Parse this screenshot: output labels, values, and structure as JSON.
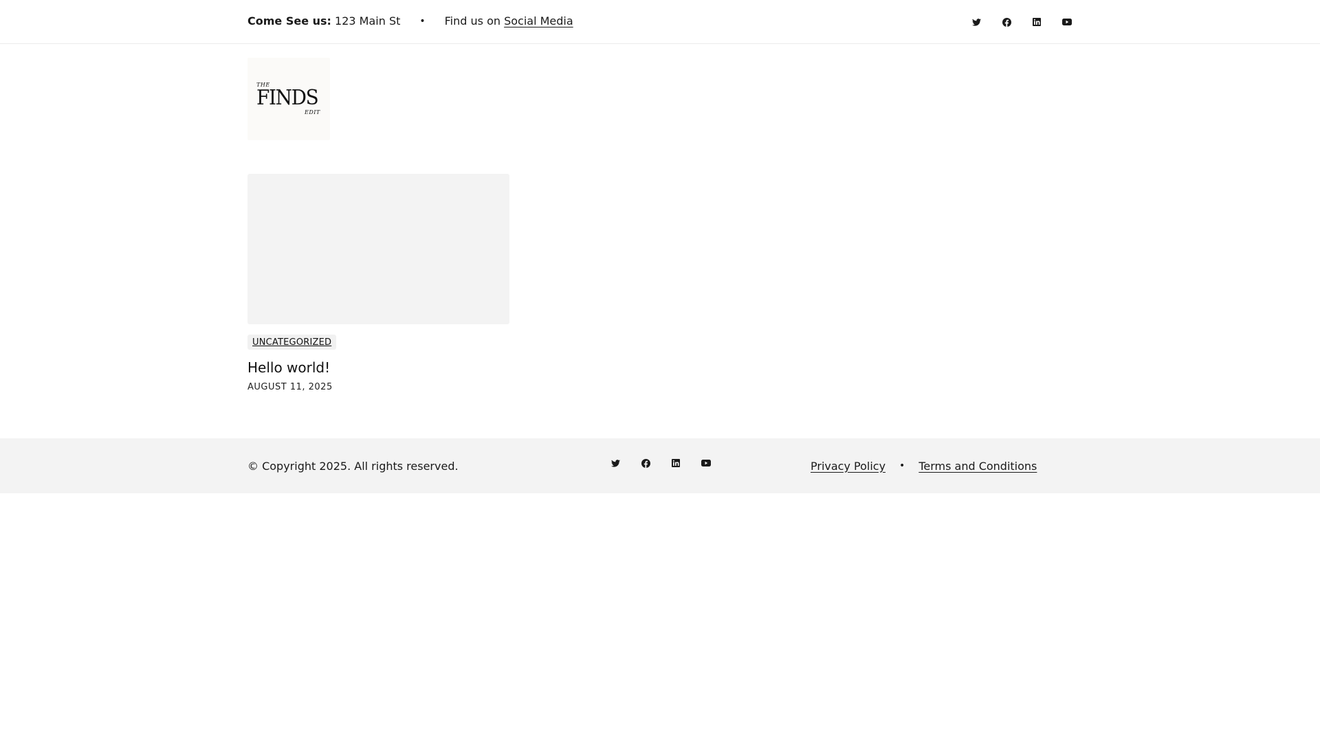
{
  "topbar": {
    "address_label": "Come See us:",
    "address_value": "123 Main St",
    "separator": "•",
    "social_prefix": "Find us on",
    "social_link": "Social Media",
    "social_icons": [
      "twitter-icon",
      "facebook-icon",
      "linkedin-icon",
      "youtube-icon"
    ]
  },
  "logo": {
    "line1": "THE",
    "line2": "FINDS",
    "line3": "EDIT"
  },
  "posts": [
    {
      "category": "UNCATEGORIZED",
      "title": "Hello world!",
      "date": "AUGUST 11, 2025"
    }
  ],
  "footer": {
    "copyright": "© Copyright 2025. All rights reserved.",
    "social_icons": [
      "twitter-icon",
      "facebook-icon",
      "linkedin-icon",
      "youtube-icon"
    ],
    "links": [
      "Privacy Policy",
      "Terms and Conditions"
    ],
    "separator": "•"
  },
  "colors": {
    "footer_bg": "#f3f3f3",
    "thumb_placeholder": "#f3f3f3",
    "text": "#1a1a1a"
  }
}
